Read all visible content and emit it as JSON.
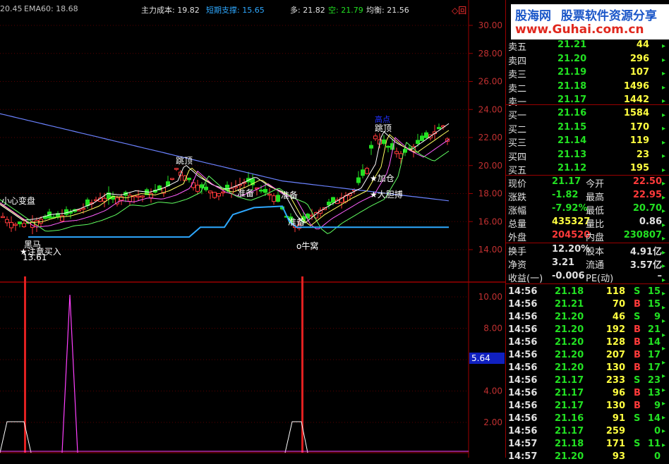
{
  "indicators": {
    "ma_prefix": "20.45",
    "ema60": "EMA60: 18.68",
    "main_cost": "主力成本: 19.82",
    "short_support": "短期支撑: 15.65",
    "long_label": "多: 21.82",
    "short_label": "空: 21.79",
    "balance_label": "均衡: 21.56",
    "window_icons": "◇回"
  },
  "watermark": {
    "brand": "股海网",
    "slogan": "股票软件资源分享",
    "url": "www.Guhai.com.cn"
  },
  "price_axis": [
    "30.00",
    "28.00",
    "26.00",
    "24.00",
    "22.00",
    "20.00",
    "18.00",
    "16.00",
    "14.00"
  ],
  "volume_axis": [
    "10.00",
    "8.00",
    "6.00",
    "4.00",
    "2.00"
  ],
  "volume_marker": "5.64",
  "signals": {
    "top1": "跳顶",
    "top2": "跳顶",
    "top3": "跳顶",
    "point": "高点",
    "caution": "小心变盘",
    "dark_horse": "黑马",
    "attention_buy": "★注意买入",
    "low_price": "13.61",
    "prepare1": "准备",
    "prepare2": "准备",
    "prepare3": "准备",
    "cow_nest": "o牛窝",
    "add_position": "★加仓",
    "bold_bet": "★大胆搏"
  },
  "orderbook": {
    "asks": [
      {
        "label": "卖五",
        "price": "21.21",
        "vol": "44"
      },
      {
        "label": "卖四",
        "price": "21.20",
        "vol": "296"
      },
      {
        "label": "卖三",
        "price": "21.19",
        "vol": "107"
      },
      {
        "label": "卖二",
        "price": "21.18",
        "vol": "1496"
      },
      {
        "label": "卖一",
        "price": "21.17",
        "vol": "1442"
      }
    ],
    "bids": [
      {
        "label": "买一",
        "price": "21.16",
        "vol": "1584"
      },
      {
        "label": "买二",
        "price": "21.15",
        "vol": "170"
      },
      {
        "label": "买三",
        "price": "21.14",
        "vol": "119"
      },
      {
        "label": "买四",
        "price": "21.13",
        "vol": "23"
      },
      {
        "label": "买五",
        "price": "21.12",
        "vol": "195"
      }
    ]
  },
  "quote": [
    {
      "l1": "现价",
      "v1": "21.17",
      "l2": "今开",
      "v2": "22.50"
    },
    {
      "l1": "涨跌",
      "v1": "-1.82",
      "l2": "最高",
      "v2": "22.95"
    },
    {
      "l1": "涨幅",
      "v1": "-7.92%",
      "l2": "最低",
      "v2": "20.70"
    },
    {
      "l1": "总量",
      "v1": "435327",
      "l2": "量比",
      "v2": "0.86"
    },
    {
      "l1": "外盘",
      "v1": "204520",
      "l2": "内盘",
      "v2": "230807"
    },
    {
      "l1": "换手",
      "v1": "12.20%",
      "l2": "股本",
      "v2": "4.91亿"
    },
    {
      "l1": "净资",
      "v1": "3.21",
      "l2": "流通",
      "v2": "3.57亿"
    },
    {
      "l1": "收益(一)",
      "v1": "-0.006",
      "l2": "PE(动)",
      "v2": "–"
    }
  ],
  "ticks": [
    {
      "time": "14:56",
      "price": "21.18",
      "vol": "118",
      "side": "S",
      "n": "15"
    },
    {
      "time": "14:56",
      "price": "21.21",
      "vol": "70",
      "side": "B",
      "n": "15"
    },
    {
      "time": "14:56",
      "price": "21.20",
      "vol": "46",
      "side": "S",
      "n": "9"
    },
    {
      "time": "14:56",
      "price": "21.20",
      "vol": "192",
      "side": "B",
      "n": "21"
    },
    {
      "time": "14:56",
      "price": "21.20",
      "vol": "128",
      "side": "B",
      "n": "14"
    },
    {
      "time": "14:56",
      "price": "21.20",
      "vol": "207",
      "side": "B",
      "n": "17"
    },
    {
      "time": "14:56",
      "price": "21.20",
      "vol": "130",
      "side": "B",
      "n": "17"
    },
    {
      "time": "14:56",
      "price": "21.17",
      "vol": "233",
      "side": "S",
      "n": "23"
    },
    {
      "time": "14:56",
      "price": "21.17",
      "vol": "96",
      "side": "B",
      "n": "13"
    },
    {
      "time": "14:56",
      "price": "21.17",
      "vol": "130",
      "side": "B",
      "n": "9"
    },
    {
      "time": "14:56",
      "price": "21.16",
      "vol": "91",
      "side": "S",
      "n": "14"
    },
    {
      "time": "14:56",
      "price": "21.17",
      "vol": "259",
      "side": "",
      "n": "0"
    },
    {
      "time": "14:57",
      "price": "21.18",
      "vol": "171",
      "side": "S",
      "n": "11"
    },
    {
      "time": "14:57",
      "price": "21.20",
      "vol": "93",
      "side": "",
      "n": "0"
    }
  ],
  "colors": {
    "up": "#ff3a3a",
    "down": "#22e022",
    "grid": "#9b0000",
    "accent": "#ffff00",
    "bg": "#000000"
  }
}
